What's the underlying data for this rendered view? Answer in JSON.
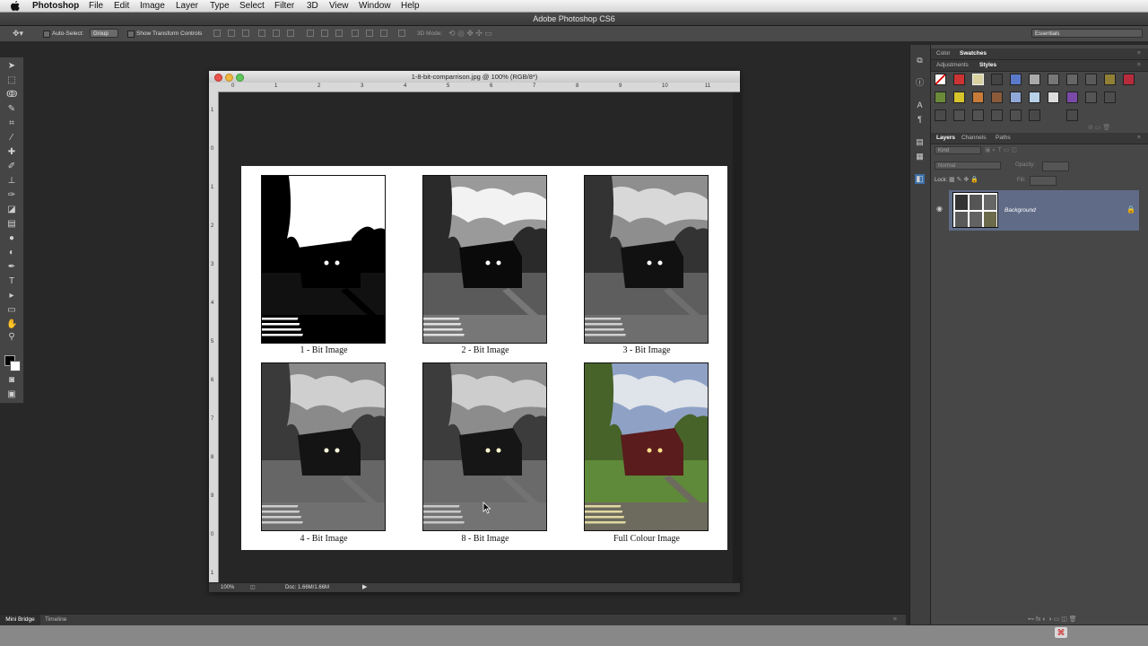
{
  "menubar": {
    "app_name": "Photoshop",
    "items": [
      "File",
      "Edit",
      "Image",
      "Layer",
      "Type",
      "Select",
      "Filter",
      "3D",
      "View",
      "Window",
      "Help"
    ]
  },
  "app_title": "Adobe Photoshop CS6",
  "options_bar": {
    "auto_select_label": "Auto-Select:",
    "auto_select_value": "Group",
    "show_transform_label": "Show Transform Controls",
    "mode_3d_label": "3D Mode:",
    "workspace": "Essentials"
  },
  "document": {
    "title": "1-8-bit-comparrison.jpg @ 100% (RGB/8*)",
    "ruler_top": [
      "0",
      "1",
      "2",
      "3",
      "4",
      "5",
      "6",
      "7",
      "8",
      "9",
      "10",
      "11"
    ],
    "ruler_left": [
      "1",
      "0",
      "1",
      "2",
      "3",
      "4",
      "5",
      "6",
      "7",
      "8",
      "9",
      "0",
      "1"
    ],
    "images": [
      {
        "label": "1 - Bit Image"
      },
      {
        "label": "2 - Bit Image"
      },
      {
        "label": "3 - Bit Image"
      },
      {
        "label": "4 - Bit Image"
      },
      {
        "label": "8 - Bit Image"
      },
      {
        "label": "Full Colour Image"
      }
    ],
    "zoom": "100%",
    "doc_size": "Doc: 1.66M/1.66M"
  },
  "bottom_tabs": [
    "Mini Bridge",
    "Timeline"
  ],
  "panels": {
    "color_tabs": [
      "Color",
      "Swatches"
    ],
    "style_tabs": [
      "Adjustments",
      "Styles"
    ],
    "layers_tabs": [
      "Layers",
      "Channels",
      "Paths"
    ],
    "kind_label": "Kind",
    "blend_mode": "Normal",
    "opacity_label": "Opacity:",
    "lock_label": "Lock:",
    "fill_label": "Fill:",
    "layer_name": "Background"
  },
  "colors": {
    "ui_dark": "#282828",
    "panel": "#474747",
    "layer_selected": "#606c87"
  }
}
